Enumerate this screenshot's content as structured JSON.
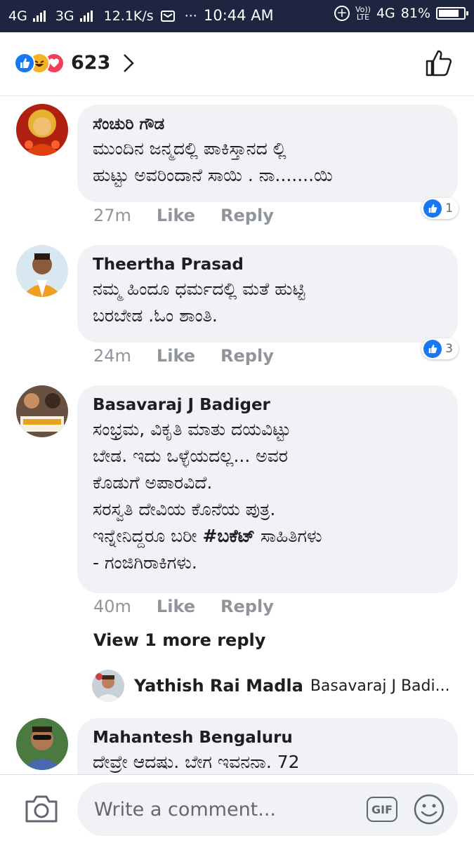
{
  "status_bar": {
    "network1": "4G",
    "network2": "3G",
    "speed": "12.1K/s",
    "dots": "···",
    "time": "10:44 AM",
    "volte_top": "Vo))",
    "volte_bottom": "LTE",
    "network3": "4G",
    "battery": "81%",
    "battery_level": 0.81
  },
  "header": {
    "reaction_count": "623",
    "reaction_icons": [
      "like-icon",
      "haha-icon",
      "love-icon"
    ]
  },
  "comments": [
    {
      "name": "ಸೆಂಚುರಿ ಗೌಡ",
      "text": "ಮುಂದಿನ ಜನ್ಮದಲ್ಲಿ ಪಾಕಿಸ್ತಾನದ ಲ್ಲಿ\nಹುಟ್ಟು ಅವರಿಂದಾನೆ ಸಾಯಿ . ನಾ.......ಯಿ",
      "time": "27m",
      "like": "Like",
      "reply": "Reply",
      "likes": "1"
    },
    {
      "name": "Theertha Prasad",
      "text": "ನಮ್ಮ ಹಿಂದೂ ಧರ್ಮದಲ್ಲಿ ಮತೆ ಹುಟ್ಟಿ\nಬರಬೇಡ .ಓಂ ಶಾಂತಿ.",
      "time": "24m",
      "like": "Like",
      "reply": "Reply",
      "likes": "3"
    },
    {
      "name": "Basavaraj J Badiger",
      "text_before": "ಸಂಭ್ರಮ, ವಿಕೃತಿ ಮಾತು ದಯವಿಟ್ಟು\nಬೇಡ. ಇದು ಒಳ್ಳೆಯದಲ್ಲ... ಅವರ\nಕೊಡುಗೆ ಅಪಾರವಿದೆ.\nಸರಸ್ವತಿ ದೇವಿಯ ಕೊನೆಯ ಪುತ್ರ.\nಇನ್ನೇನಿದ್ದರೂ ಬರೀ ",
      "hashtag": "#ಬಕೆಟ್",
      "text_after": " ಸಾಹಿತಿಗಳು\n- ಗಂಜಿಗಿರಾಕಿಗಳು.",
      "time": "40m",
      "like": "Like",
      "reply": "Reply"
    },
    {
      "name": "Mahantesh Bengaluru",
      "text": "ದೇವ್ರೇ ಆದಷು. ಬೇಗ ಇವನನಾ. 72"
    }
  ],
  "more_replies": "View 1 more reply",
  "reply_preview": {
    "name": "Yathish Rai Madla",
    "snippet": "Basavaraj J Badi..."
  },
  "composer": {
    "placeholder": "Write a comment...",
    "gif_label": "GIF"
  },
  "colors": {
    "accent": "#1877f2",
    "bubble": "#f0f2f5",
    "meta": "#90949c",
    "status_bar": "#1d2540"
  }
}
